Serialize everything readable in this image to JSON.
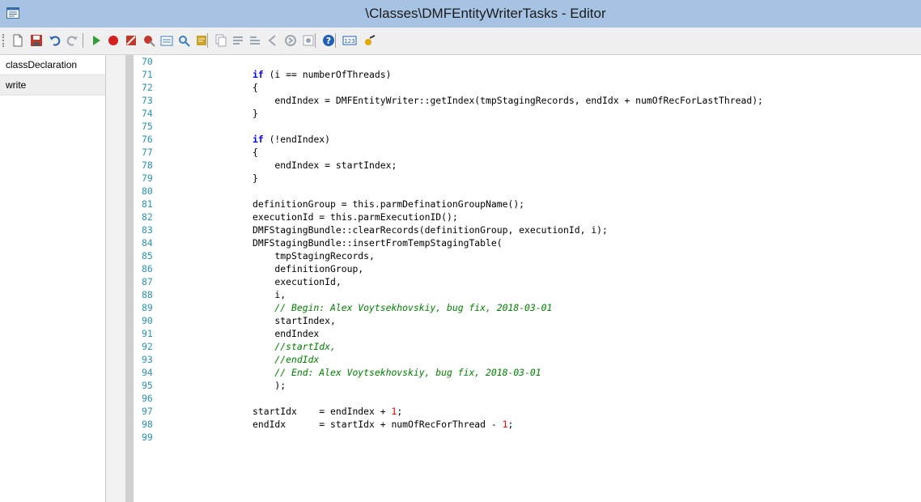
{
  "window": {
    "title": "\\Classes\\DMFEntityWriterTasks - Editor"
  },
  "toolbar": {
    "buttons": [
      {
        "icon": "new-icon",
        "color": "#ffffff"
      },
      {
        "icon": "save-icon",
        "color": "#c0392b"
      },
      {
        "icon": "undo-icon",
        "color": "#1f5fb4"
      },
      {
        "icon": "redo-icon",
        "color": "#9aa6b2"
      },
      {
        "icon": "run-icon",
        "color": "#2e9e3a"
      },
      {
        "icon": "breakpoint-icon",
        "color": "#d62020"
      },
      {
        "icon": "enable-breakpoint-icon",
        "color": "#c0392b"
      },
      {
        "icon": "remove-breakpoints-icon",
        "color": "#c0392b"
      },
      {
        "icon": "compile-icon",
        "color": "#3b7dbf"
      },
      {
        "icon": "lookup-icon",
        "color": "#3b7dbf"
      },
      {
        "icon": "script-icon",
        "color": "#c9a227"
      },
      {
        "icon": "copy-icon",
        "color": "#9aa6b2"
      },
      {
        "icon": "comment-icon",
        "color": "#9aa6b2"
      },
      {
        "icon": "uncomment-icon",
        "color": "#9aa6b2"
      },
      {
        "icon": "back-icon",
        "color": "#9aa6b2"
      },
      {
        "icon": "forward-icon",
        "color": "#9aa6b2"
      },
      {
        "icon": "references-icon",
        "color": "#9aa6b2"
      },
      {
        "icon": "help-icon",
        "color": "#1f5fb4"
      },
      {
        "icon": "line-numbers-icon",
        "color": "#1f5fb4"
      },
      {
        "icon": "bp-icon",
        "color": "#e0a800"
      }
    ]
  },
  "sidebar": {
    "methods": [
      "classDeclaration",
      "write"
    ]
  },
  "editor": {
    "lines": [
      {
        "n": "70",
        "t": ""
      },
      {
        "n": "71",
        "t": "if (i == numberOfThreads)"
      },
      {
        "n": "72",
        "t": "{"
      },
      {
        "n": "73",
        "t": "    endIndex = DMFEntityWriter::getIndex(tmpStagingRecords, endIdx + numOfRecForLastThread);"
      },
      {
        "n": "74",
        "t": "}"
      },
      {
        "n": "75",
        "t": ""
      },
      {
        "n": "76",
        "t": "if (!endIndex)"
      },
      {
        "n": "77",
        "t": "{"
      },
      {
        "n": "78",
        "t": "    endIndex = startIndex;"
      },
      {
        "n": "79",
        "t": "}"
      },
      {
        "n": "80",
        "t": ""
      },
      {
        "n": "81",
        "t": "definitionGroup = this.parmDefinationGroupName();"
      },
      {
        "n": "82",
        "t": "executionId = this.parmExecutionID();"
      },
      {
        "n": "83",
        "t": "DMFStagingBundle::clearRecords(definitionGroup, executionId, i);"
      },
      {
        "n": "84",
        "t": "DMFStagingBundle::insertFromTempStagingTable("
      },
      {
        "n": "85",
        "t": "    tmpStagingRecords,"
      },
      {
        "n": "86",
        "t": "    definitionGroup,"
      },
      {
        "n": "87",
        "t": "    executionId,"
      },
      {
        "n": "88",
        "t": "    i,"
      },
      {
        "n": "89",
        "t": "    // Begin: Alex Voytsekhovskiy, bug fix, 2018-03-01"
      },
      {
        "n": "90",
        "t": "    startIndex,"
      },
      {
        "n": "91",
        "t": "    endIndex"
      },
      {
        "n": "92",
        "t": "    //startIdx,"
      },
      {
        "n": "93",
        "t": "    //endIdx"
      },
      {
        "n": "94",
        "t": "    // End: Alex Voytsekhovskiy, bug fix, 2018-03-01"
      },
      {
        "n": "95",
        "t": "    );"
      },
      {
        "n": "96",
        "t": ""
      },
      {
        "n": "97",
        "t": "startIdx    = endIndex + 1;"
      },
      {
        "n": "98",
        "t": "endIdx      = startIdx + numOfRecForThread - 1;"
      },
      {
        "n": "99",
        "t": ""
      }
    ]
  }
}
